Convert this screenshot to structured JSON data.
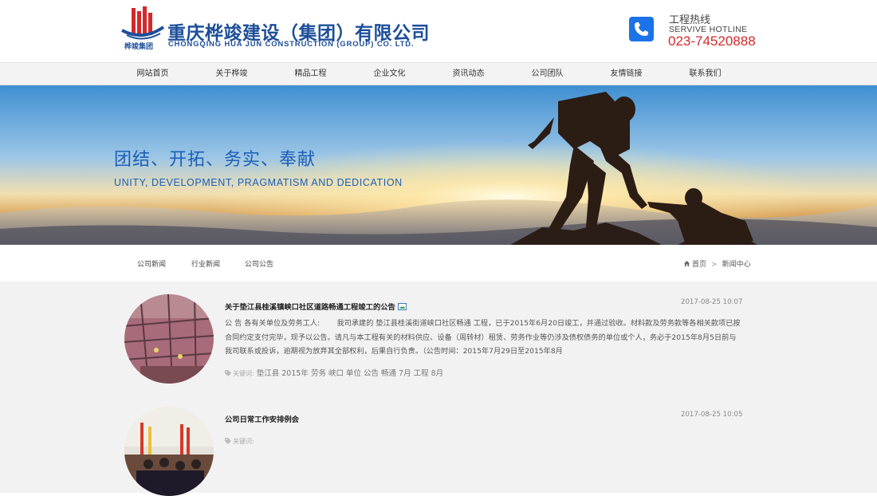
{
  "header": {
    "logo_text": "桦竣集团",
    "company_name_cn": "重庆桦竣建设（集团）有限公司",
    "company_name_en": "CHONGQING HUA JUN CONSTRUCTION (GROUP) CO. LTD.",
    "hotline_title": "工程热线",
    "hotline_en": "SERVIVE HOTLINE",
    "hotline_number": "023-74520888",
    "phone_icon": "phone-icon"
  },
  "nav": {
    "items": [
      {
        "label": "网站首页"
      },
      {
        "label": "关于桦竣"
      },
      {
        "label": "精品工程"
      },
      {
        "label": "企业文化"
      },
      {
        "label": "资讯动态"
      },
      {
        "label": "公司团队"
      },
      {
        "label": "友情链接"
      },
      {
        "label": "联系我们"
      }
    ]
  },
  "banner": {
    "slogan_cn": "团结、开拓、务实、奉献",
    "slogan_en": "UNITY, DEVELOPMENT, PRAGMATISM AND DEDICATION"
  },
  "subnav": {
    "items": [
      {
        "label": "公司新闻"
      },
      {
        "label": "行业新闻"
      },
      {
        "label": "公司公告"
      }
    ],
    "breadcrumb": {
      "home": "首页",
      "separator": ">",
      "current": "新闻中心"
    }
  },
  "news": [
    {
      "title": "关于垫江县桂溪镇峡口社区道路畅通工程竣工的公告",
      "date": "2017-08-25 10:07",
      "summary": "公 告 各有关单位及劳务工人:　　 我司承建的 垫江县桂溪街道峡口社区畅通 工程，已于2015年6月20日竣工，并通过验收。材料款及劳务款等各相关款项已按合同约定支付完毕，现予以公告。请凡与本工程有关的材料供应、设备（周转材）租赁、劳务作业等仍涉及债权债务的单位或个人，务必于2015年8月5日前与我司联系或投诉，逾期视为放弃其全部权利，后果自行负责。（公告时间：2015年7月29日至2015年8月",
      "keywords_label": "关键词:",
      "keywords": "垫江县 2015年 劳务 峡口 单位 公告 畅通 7月 工程 8月"
    },
    {
      "title": "公司日常工作安排例会",
      "date": "2017-08-25 10:05",
      "keywords_label": "关键词:",
      "keywords": ""
    }
  ],
  "colors": {
    "brand_blue": "#1d4e9a",
    "hotline_red": "#d4292a",
    "slogan_blue": "#1d5fb8"
  }
}
